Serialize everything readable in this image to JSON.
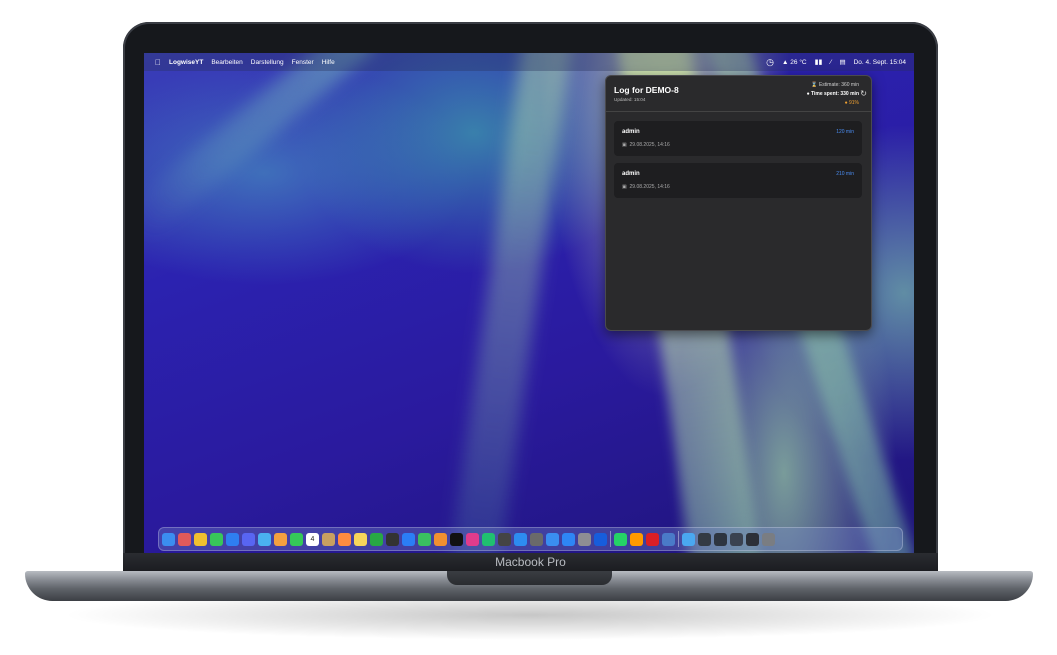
{
  "device_label": "Macbook Pro",
  "menubar": {
    "apple_icon": "apple-icon",
    "app_name": "LogwiseYT",
    "menus": [
      "Bearbeiten",
      "Darstellung",
      "Fenster",
      "Hilfe"
    ],
    "weather": "26 °C",
    "datetime": "Do. 4. Sept.  15:04"
  },
  "popup": {
    "title": "Log for DEMO-8",
    "updated": "Updated: 15:04",
    "estimate": "Estimate: 360 min",
    "time_spent": "Time spent: 330 min",
    "percent": "91%",
    "entries": [
      {
        "user": "admin",
        "duration": "120 min",
        "date": "29.08.2025, 14:16"
      },
      {
        "user": "admin",
        "duration": "210 min",
        "date": "29.08.2025, 14:16"
      }
    ]
  },
  "dock": {
    "icons": [
      "finder-icon",
      "launchpad-icon",
      "chrome-icon",
      "messages-icon",
      "mail-icon",
      "discord-icon",
      "preview-icon",
      "photos-icon",
      "facetime-icon",
      "calendar-icon",
      "notes-icon",
      "reminders-icon",
      "stickies-icon",
      "numbers-icon",
      "final-cut-icon",
      "keynote-icon",
      "numbers-chart-icon",
      "pages-icon",
      "chatgpt-icon",
      "intellij-icon",
      "pycharm-icon",
      "stack-icon",
      "xcode-icon",
      "github-icon",
      "maps-icon",
      "app-store-icon",
      "settings-icon",
      "bitwarden-icon",
      "whatsapp-icon",
      "illustrator-icon",
      "creative-cloud-icon",
      "screen-sharing-icon",
      "folder-icon",
      "window-icon",
      "window-icon-2",
      "window-icon-3",
      "window-icon-4",
      "trash-icon"
    ],
    "calendar_day": "4",
    "colors": [
      "#3b8df0",
      "#e05a5a",
      "#f0c030",
      "#38c65a",
      "#2f7ef0",
      "#5865f2",
      "#4ab0f0",
      "#f4a040",
      "#35c859",
      "#ffffff",
      "#c8a060",
      "#ff8c40",
      "#f6d55c",
      "#28a745",
      "#333333",
      "#2b7ef6",
      "#3ac060",
      "#f09030",
      "#111111",
      "#e03c8c",
      "#20c070",
      "#444444",
      "#2d8cf0",
      "#6a6a6a",
      "#3a8ef0",
      "#2e86f5",
      "#8e8e93",
      "#175ddc",
      "#25d366",
      "#ff9a00",
      "#da1f26",
      "#4a7ac8",
      "#4aa8f0",
      "#333a44",
      "#2e3540",
      "#3a4250",
      "#2c3038",
      "#7a7d82"
    ]
  }
}
